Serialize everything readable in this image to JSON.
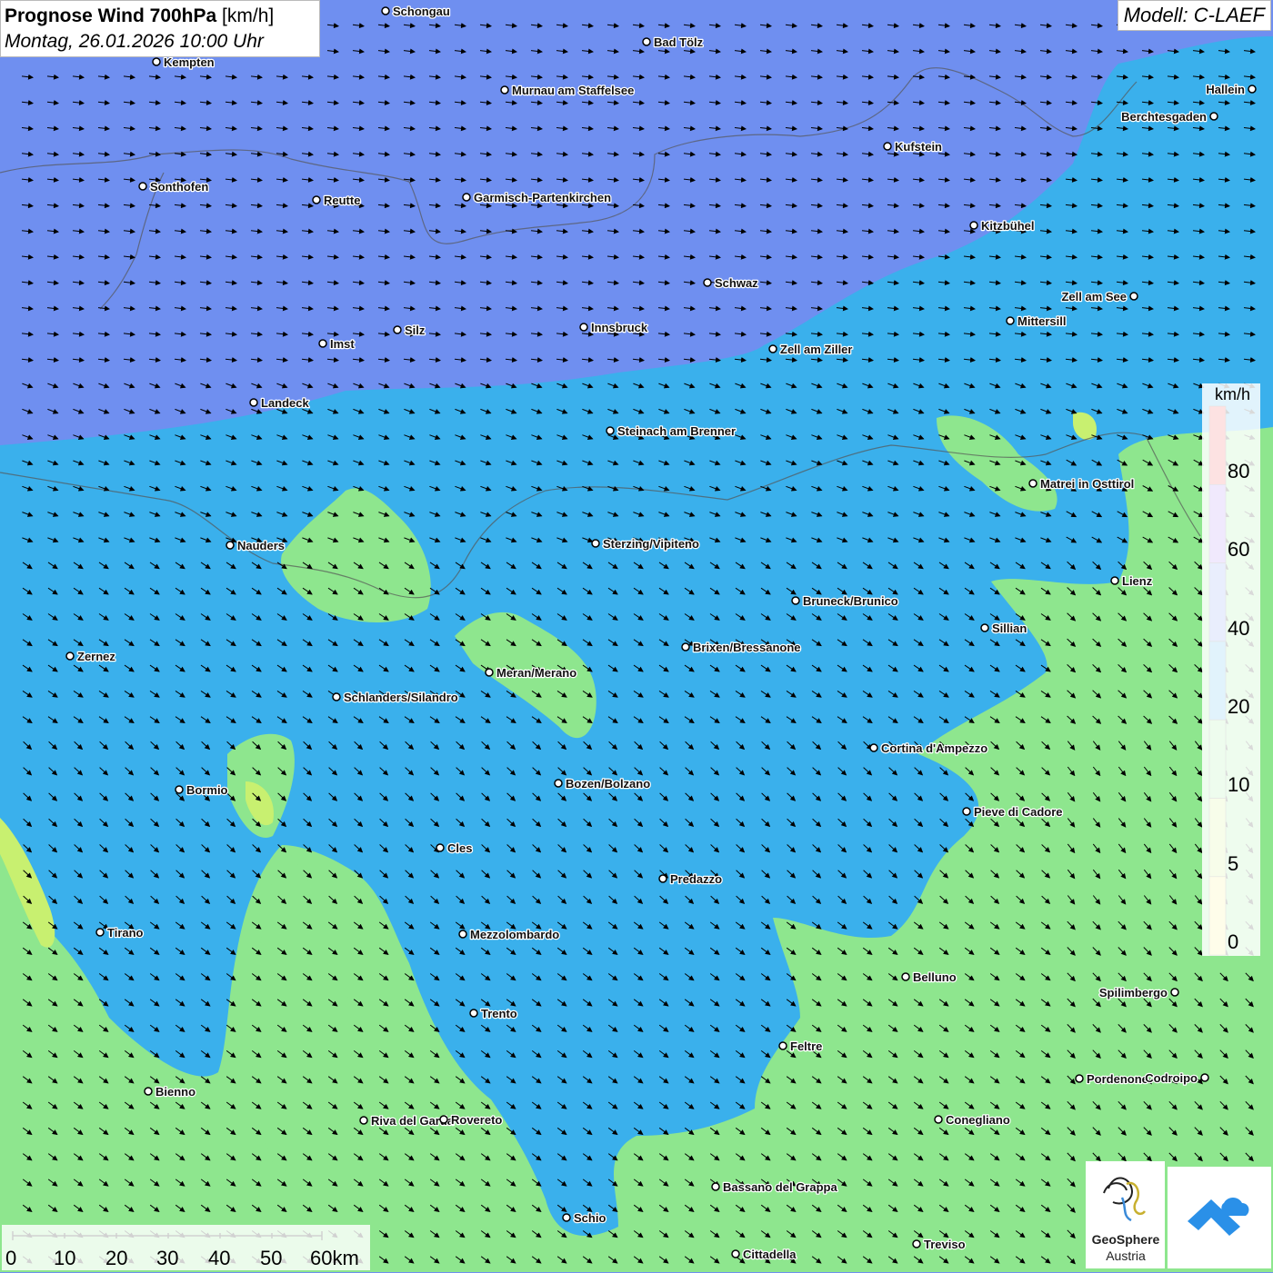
{
  "title": {
    "bold": "Prognose Wind 700hPa",
    "unit": "[km/h]",
    "date": "Montag, 26.01.2026 10:00 Uhr"
  },
  "model": "Modell: C-LAEF",
  "legend": {
    "unit": "km/h",
    "labels": [
      "80",
      "60",
      "40",
      "20",
      "10",
      "5",
      "0"
    ],
    "colors": [
      "#f23c3c",
      "#9b6cf0",
      "#6f8ff0",
      "#3ab0ec",
      "#8ee68e",
      "#c8f070",
      "#f4f070"
    ]
  },
  "scale": {
    "labels": [
      "0",
      "10",
      "20",
      "30",
      "40",
      "50",
      "60km"
    ]
  },
  "logos": {
    "geosphere_line1": "GeoSphere",
    "geosphere_line2": "Austria",
    "geosphere_icon": "geosphere-logo-icon",
    "partner_icon": "partner-logo-icon"
  },
  "cities": [
    {
      "name": "Schongau",
      "lon": 424,
      "lat": 12
    },
    {
      "name": "Bad Tölz",
      "lon": 711,
      "lat": 46
    },
    {
      "name": "Kempten",
      "lon": 172,
      "lat": 68
    },
    {
      "name": "Murnau am Staffelsee",
      "lon": 555,
      "lat": 99
    },
    {
      "name": "Hallein",
      "lon": 1377,
      "lat": 98
    },
    {
      "name": "Berchtesgaden",
      "lon": 1335,
      "lat": 128
    },
    {
      "name": "Kufstein",
      "lon": 976,
      "lat": 161
    },
    {
      "name": "Sonthofen",
      "lon": 157,
      "lat": 205
    },
    {
      "name": "Reutte",
      "lon": 348,
      "lat": 220
    },
    {
      "name": "Garmisch-Partenkirchen",
      "lon": 513,
      "lat": 217
    },
    {
      "name": "Kitzbühel",
      "lon": 1071,
      "lat": 248
    },
    {
      "name": "Schwaz",
      "lon": 778,
      "lat": 311
    },
    {
      "name": "Zell am See",
      "lon": 1247,
      "lat": 326
    },
    {
      "name": "Mittersill",
      "lon": 1111,
      "lat": 353
    },
    {
      "name": "Innsbruck",
      "lon": 642,
      "lat": 360
    },
    {
      "name": "Silz",
      "lon": 437,
      "lat": 363
    },
    {
      "name": "Imst",
      "lon": 355,
      "lat": 378
    },
    {
      "name": "Zell am Ziller",
      "lon": 850,
      "lat": 384
    },
    {
      "name": "Landeck",
      "lon": 279,
      "lat": 443
    },
    {
      "name": "Steinach am Brenner",
      "lon": 671,
      "lat": 474
    },
    {
      "name": "Matrei in Osttirol",
      "lon": 1136,
      "lat": 532
    },
    {
      "name": "Nauders",
      "lon": 253,
      "lat": 600
    },
    {
      "name": "Sterzing/Vipiteno",
      "lon": 655,
      "lat": 598
    },
    {
      "name": "Lienz",
      "lon": 1226,
      "lat": 639
    },
    {
      "name": "Bruneck/Brunico",
      "lon": 875,
      "lat": 661
    },
    {
      "name": "Sillian",
      "lon": 1083,
      "lat": 691
    },
    {
      "name": "Zernez",
      "lon": 77,
      "lat": 722
    },
    {
      "name": "Brixen/Bressanone",
      "lon": 754,
      "lat": 712
    },
    {
      "name": "Meran/Merano",
      "lon": 538,
      "lat": 740
    },
    {
      "name": "Schlanders/Silandro",
      "lon": 370,
      "lat": 767
    },
    {
      "name": "Cortina d'Ampezzo",
      "lon": 961,
      "lat": 823
    },
    {
      "name": "Bozen/Bolzano",
      "lon": 614,
      "lat": 862
    },
    {
      "name": "Bormio",
      "lon": 197,
      "lat": 869
    },
    {
      "name": "Pieve di Cadore",
      "lon": 1063,
      "lat": 893
    },
    {
      "name": "Cles",
      "lon": 484,
      "lat": 933
    },
    {
      "name": "Predazzo",
      "lon": 729,
      "lat": 967
    },
    {
      "name": "Tirano",
      "lon": 110,
      "lat": 1026
    },
    {
      "name": "Mezzolombardo",
      "lon": 509,
      "lat": 1028
    },
    {
      "name": "Belluno",
      "lon": 996,
      "lat": 1075
    },
    {
      "name": "Spilimbergo",
      "lon": 1292,
      "lat": 1092
    },
    {
      "name": "Trento",
      "lon": 521,
      "lat": 1115
    },
    {
      "name": "Feltre",
      "lon": 861,
      "lat": 1151
    },
    {
      "name": "Pordenone",
      "lon": 1187,
      "lat": 1187
    },
    {
      "name": "Codroipo",
      "lon": 1325,
      "lat": 1186
    },
    {
      "name": "Bienno",
      "lon": 163,
      "lat": 1201
    },
    {
      "name": "Riva del Garda",
      "lon": 400,
      "lat": 1233
    },
    {
      "name": "Rovereto",
      "lon": 488,
      "lat": 1232
    },
    {
      "name": "Conegliano",
      "lon": 1032,
      "lat": 1232
    },
    {
      "name": "Bassano del Grappa",
      "lon": 787,
      "lat": 1306
    },
    {
      "name": "Schio",
      "lon": 623,
      "lat": 1340
    },
    {
      "name": "Treviso",
      "lon": 1008,
      "lat": 1369
    },
    {
      "name": "Cittadella",
      "lon": 809,
      "lat": 1380
    }
  ]
}
